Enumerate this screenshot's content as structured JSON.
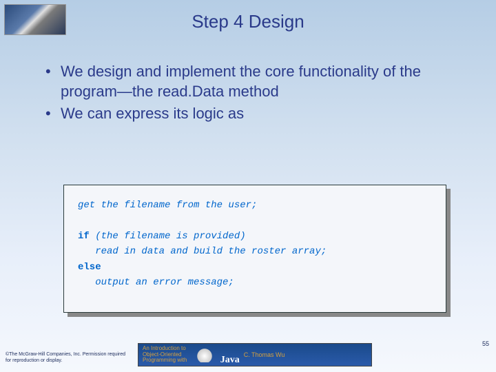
{
  "title": "Step 4 Design",
  "bullets": [
    "We design and implement the core functionality of the program—the read.Data method",
    "We can express its logic as"
  ],
  "code": {
    "line1": "get the filename from the user;",
    "kw_if": "if",
    "cond": "(the filename is provided)",
    "then": "   read in data and build the roster array;",
    "kw_else": "else",
    "else_body": "   output an error message;"
  },
  "copyright": "©The McGraw-Hill Companies, Inc. Permission required for reproduction or display.",
  "banner": {
    "intro_line1": "An Introduction to",
    "intro_line2": "Object-Oriented",
    "intro_line3": "Programming with",
    "java": "Java",
    "author": "C. Thomas Wu"
  },
  "page_number": "55"
}
